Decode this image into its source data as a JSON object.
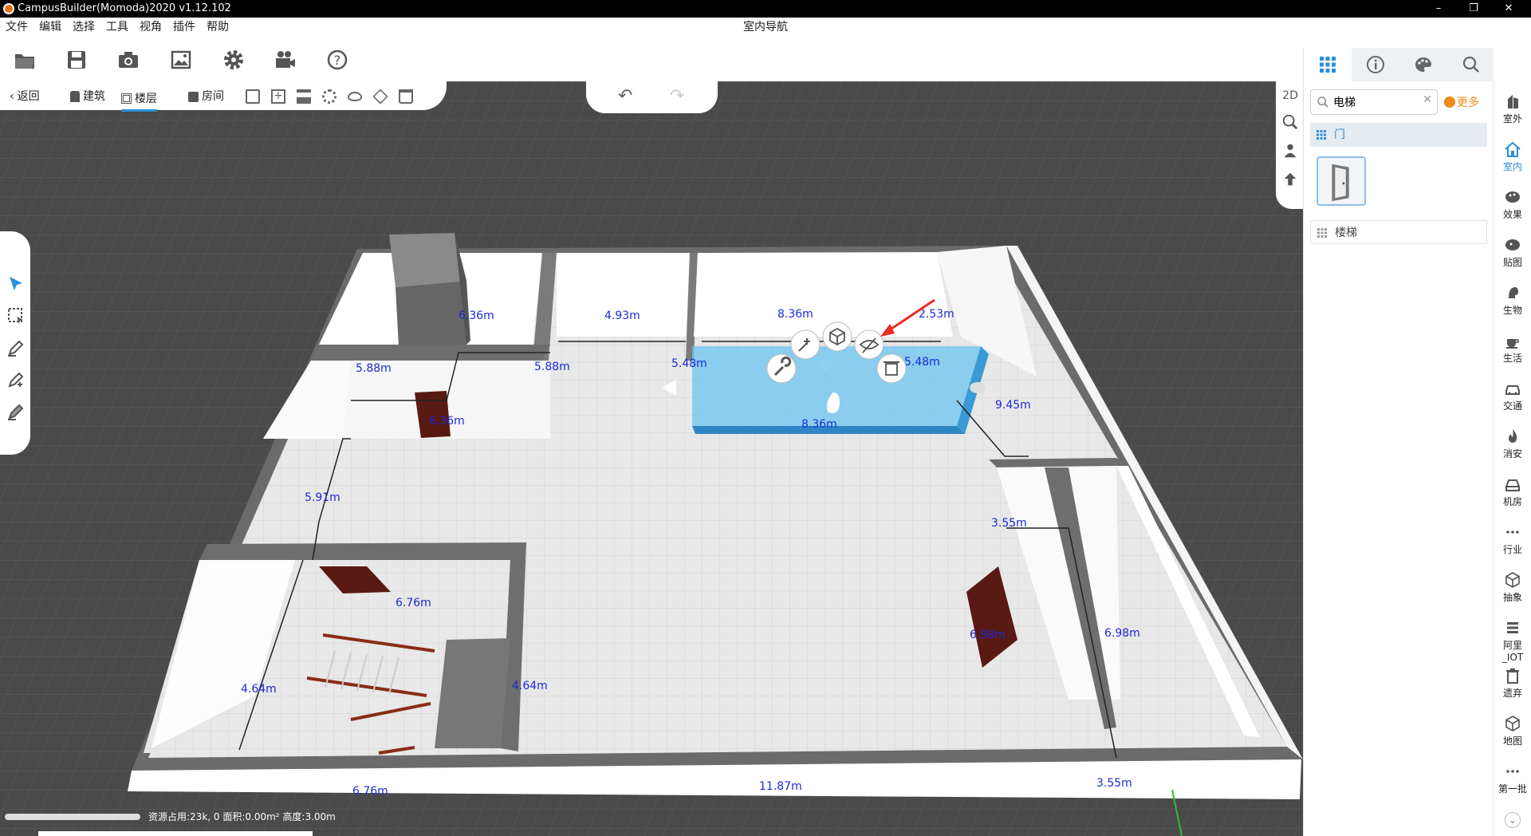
{
  "window": {
    "title": "CampusBuilder(Momoda)2020 v1.12.102",
    "minimize": "–",
    "restore": "❐",
    "close": "✕"
  },
  "menu": {
    "items": [
      "文件",
      "编辑",
      "选择",
      "工具",
      "视角",
      "插件",
      "帮助"
    ],
    "center_title": "室内导航"
  },
  "toolbar": {
    "icons": [
      "open-folder-icon",
      "save-icon",
      "camera-icon",
      "image-icon",
      "gear-icon",
      "video-camera-icon",
      "help-icon"
    ]
  },
  "subbar": {
    "back": "返回",
    "building": "建筑",
    "floor": "楼层",
    "room": "房间"
  },
  "viewtools": {
    "mode_2d": "2D"
  },
  "right_panel": {
    "search_value": "电梯",
    "more_label": "更多",
    "categories": [
      {
        "label": "门",
        "active": true
      },
      {
        "label": "楼梯",
        "active": false
      }
    ]
  },
  "category_bar": {
    "items": [
      "室外",
      "室内",
      "效果",
      "贴图",
      "生物",
      "生活",
      "交通",
      "消安",
      "机房",
      "行业",
      "抽象",
      "阿里_IOT",
      "遗弃",
      "地图",
      "第一批"
    ]
  },
  "scene": {
    "dimensions": [
      "6.36m",
      "4.93m",
      "8.36m",
      "2.53m",
      "5.88m",
      "5.88m",
      "5.48m",
      "5.48m",
      "6.36m",
      "8.36m",
      "9.45m",
      "5.91m",
      "3.55m",
      "6.76m",
      "4.64m",
      "4.64m",
      "6.98m",
      "6.98m",
      "6.76m",
      "11.87m",
      "3.55m"
    ]
  },
  "status": {
    "text": "资源占用:23k, 0   面积:0.00m²   高度:3.00m"
  },
  "colors": {
    "accent": "#2b8fd8",
    "more": "#f08a19",
    "dimension_text": "#1a2bd6",
    "selection": "#6cc4f0"
  }
}
